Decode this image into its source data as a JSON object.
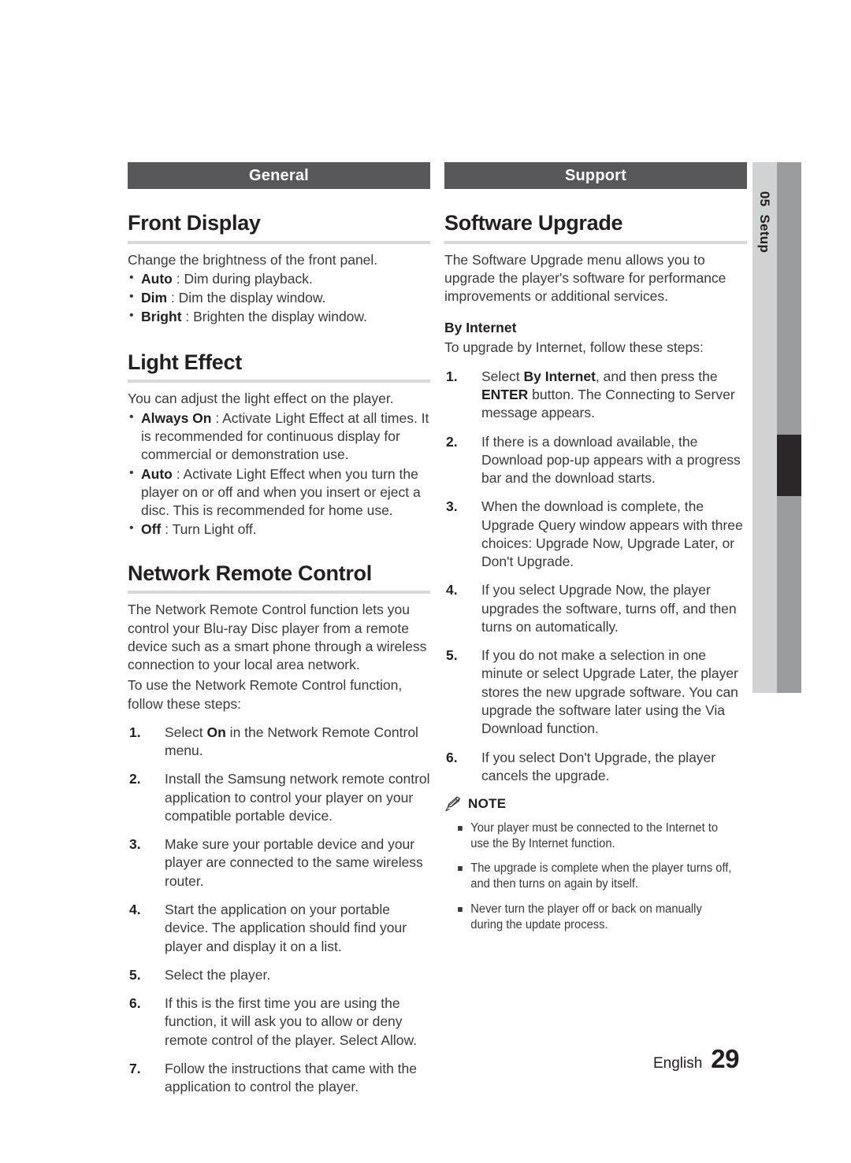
{
  "side_tab": {
    "chapter_number": "05",
    "chapter_name": "Setup"
  },
  "footer": {
    "language": "English",
    "page_number": "29"
  },
  "left_column": {
    "banner": "General",
    "sections": [
      {
        "title": "Front Display",
        "intro": "Change the brightness of the front panel.",
        "bullets": [
          {
            "term": "Auto",
            "sep": " : ",
            "text": "Dim during playback."
          },
          {
            "term": "Dim",
            "sep": " : ",
            "text": "Dim the display window."
          },
          {
            "term": "Bright",
            "sep": " : ",
            "text": "Brighten the display window."
          }
        ]
      },
      {
        "title": "Light Effect",
        "intro": "You can adjust the light effect on the player.",
        "bullets": [
          {
            "term": "Always On",
            "sep": " : ",
            "text": "Activate Light Effect at all times. It is recommended for continuous display for commercial or demonstration use."
          },
          {
            "term": "Auto",
            "sep": " : ",
            "text": "Activate Light Effect when you turn the player on or off and when you insert or eject a disc. This is recommended for home use."
          },
          {
            "term": "Off",
            "sep": " : ",
            "text": "Turn Light off."
          }
        ]
      },
      {
        "title": "Network Remote Control",
        "paragraphs": [
          "The Network Remote Control function lets you control your Blu-ray Disc player from a remote device such as a smart phone through a wireless connection to your local area network.",
          "To use the Network Remote Control function, follow these steps:"
        ],
        "steps": [
          {
            "num": "1.",
            "pre": "Select ",
            "bold": "On",
            "post": " in the Network Remote Control menu."
          },
          {
            "num": "2.",
            "pre": "Install the Samsung network remote control application to control your player on your compatible portable device.",
            "bold": "",
            "post": ""
          },
          {
            "num": "3.",
            "pre": "Make sure your portable device and your player are connected to the same wireless router.",
            "bold": "",
            "post": ""
          },
          {
            "num": "4.",
            "pre": "Start the application on your portable device. The application should find your player and display it on a list.",
            "bold": "",
            "post": ""
          },
          {
            "num": "5.",
            "pre": "Select the player.",
            "bold": "",
            "post": ""
          },
          {
            "num": "6.",
            "pre": "If this is the first time you are using the function, it will ask you to allow or deny remote control of the player. Select Allow.",
            "bold": "",
            "post": ""
          },
          {
            "num": "7.",
            "pre": "Follow the instructions that came with the application to control the player.",
            "bold": "",
            "post": ""
          }
        ]
      }
    ]
  },
  "right_column": {
    "banner": "Support",
    "section": {
      "title": "Software Upgrade",
      "intro": "The Software Upgrade menu allows you to upgrade the player's software for performance improvements or additional services.",
      "sub_title": "By Internet",
      "sub_intro": "To upgrade by Internet, follow these steps:",
      "steps": [
        {
          "num": "1.",
          "pre": "Select ",
          "bold": "By Internet",
          "mid": ", and then press the ",
          "bold2": "ENTER",
          "post": " button. The Connecting to Server message appears."
        },
        {
          "num": "2.",
          "pre": "If there is a download available, the Download pop-up appears with a progress bar and the download starts.",
          "bold": "",
          "mid": "",
          "bold2": "",
          "post": ""
        },
        {
          "num": "3.",
          "pre": "When the download is complete, the Upgrade Query window appears with three choices: Upgrade Now, Upgrade Later, or Don't Upgrade.",
          "bold": "",
          "mid": "",
          "bold2": "",
          "post": ""
        },
        {
          "num": "4.",
          "pre": "If you select Upgrade Now, the player upgrades the software, turns off, and then turns on automatically.",
          "bold": "",
          "mid": "",
          "bold2": "",
          "post": ""
        },
        {
          "num": "5.",
          "pre": "If you do not make a selection in one minute or select Upgrade Later, the player stores the new upgrade software. You can upgrade the software later using the Via Download function.",
          "bold": "",
          "mid": "",
          "bold2": "",
          "post": ""
        },
        {
          "num": "6.",
          "pre": "If you select Don't Upgrade, the player cancels the upgrade.",
          "bold": "",
          "mid": "",
          "bold2": "",
          "post": ""
        }
      ],
      "note": {
        "label": "NOTE",
        "items": [
          "Your player must be connected to the Internet to use the By Internet function.",
          "The upgrade is complete when the player turns off, and then turns on again by itself.",
          "Never turn the player off or back on manually during the update process."
        ]
      }
    }
  },
  "colors": {
    "banner_bg": "#58585a",
    "rule": "#d9d9db",
    "side_tab_light": "#d0d2d3",
    "side_tab_dark": "#9a9c9e",
    "side_tab_marker": "#2b2627",
    "text": "#3a3a3a",
    "heading": "#231f20"
  }
}
